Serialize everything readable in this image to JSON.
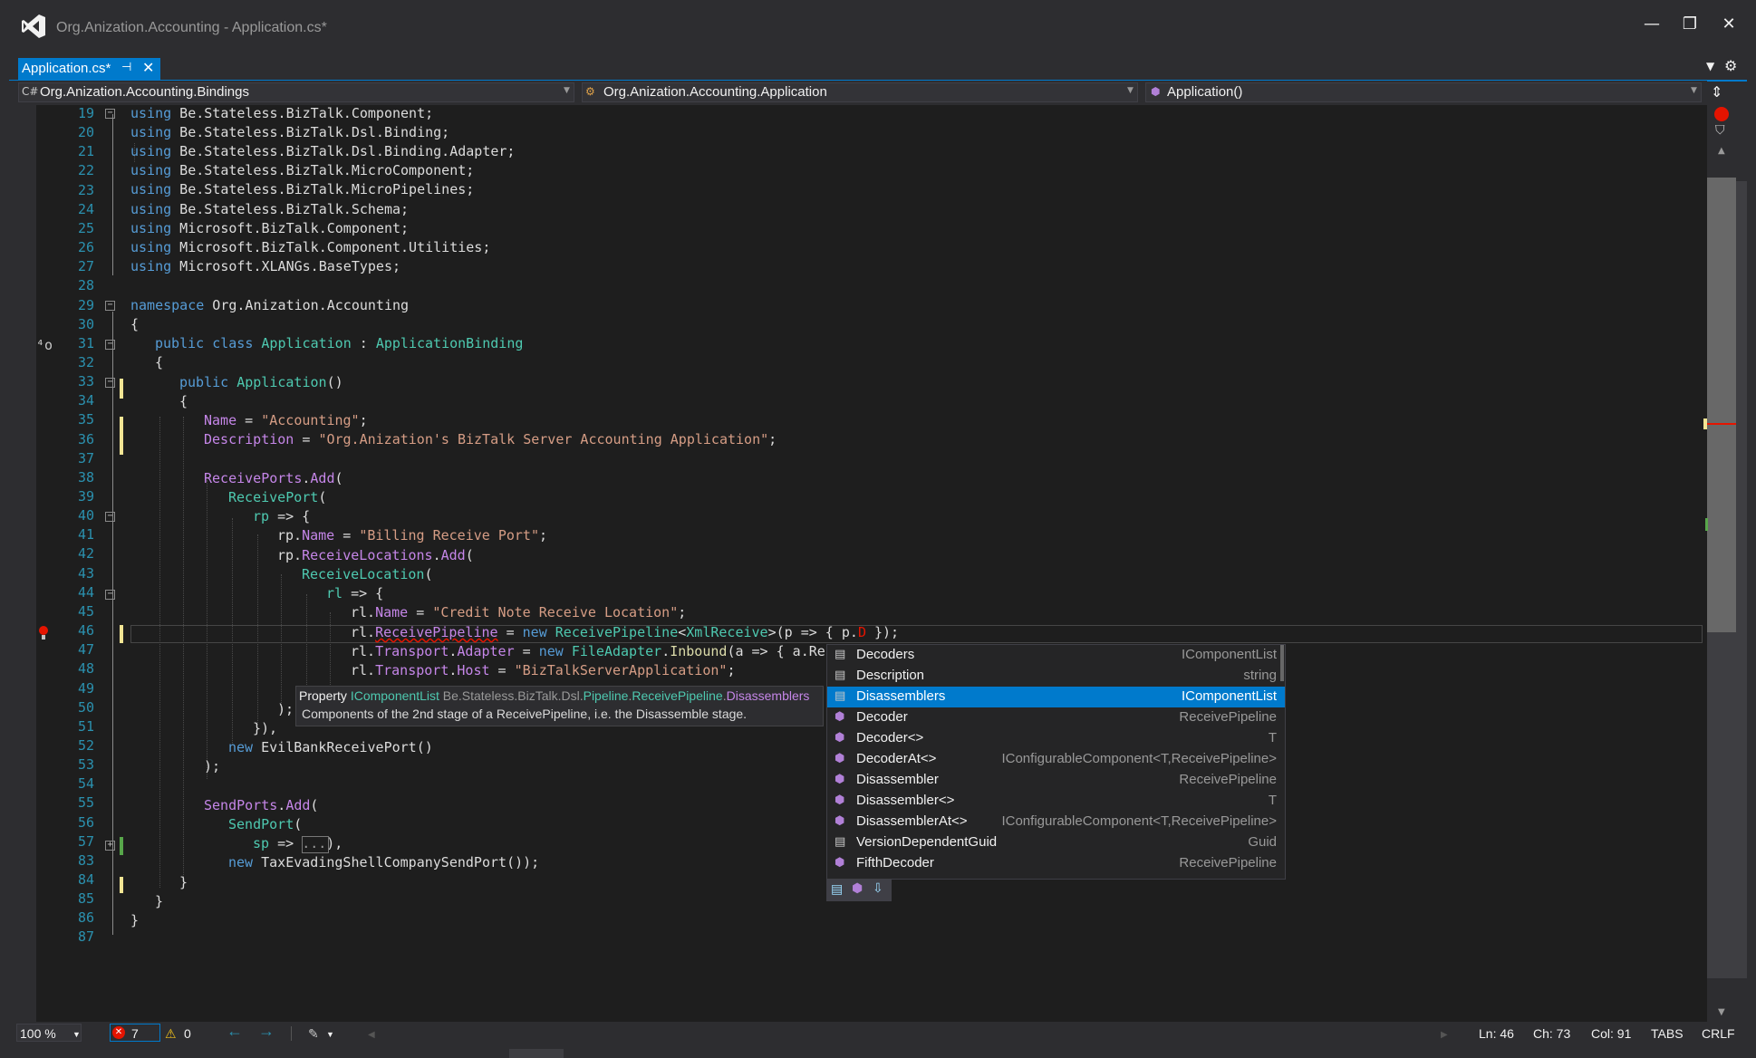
{
  "window": {
    "title": "Org.Anization.Accounting - Application.cs*",
    "minimize_glyph": "—",
    "restore_glyph": "❐",
    "close_glyph": "✕"
  },
  "tab": {
    "label": "Application.cs*",
    "pin_glyph": "⊣",
    "close_glyph": "✕",
    "active_color": "#007acc"
  },
  "navbar": {
    "project": "Org.Anization.Accounting.Bindings",
    "type": "Org.Anization.Accounting.Application",
    "member": "Application()"
  },
  "line_numbers": [
    "19",
    "20",
    "21",
    "22",
    "23",
    "24",
    "25",
    "26",
    "27",
    "28",
    "29",
    "30",
    "31",
    "32",
    "33",
    "34",
    "35",
    "36",
    "37",
    "38",
    "39",
    "40",
    "41",
    "42",
    "43",
    "44",
    "45",
    "46",
    "47",
    "48",
    "49",
    "50",
    "51",
    "52",
    "53",
    "54",
    "55",
    "56",
    "57",
    "83",
    "84",
    "85",
    "86",
    "87"
  ],
  "code": {
    "l19": [
      "using",
      " Be.Stateless.BizTalk.Component;"
    ],
    "l20": [
      "using",
      " Be.Stateless.BizTalk.Dsl.Binding;"
    ],
    "l21": [
      "using",
      " Be.Stateless.BizTalk.Dsl.Binding.Adapter;"
    ],
    "l22": [
      "using",
      " Be.Stateless.BizTalk.MicroComponent;"
    ],
    "l23": [
      "using",
      " Be.Stateless.BizTalk.MicroPipelines;"
    ],
    "l24": [
      "using",
      " Be.Stateless.BizTalk.Schema;"
    ],
    "l25": [
      "using",
      " Microsoft.BizTalk.Component;"
    ],
    "l26": [
      "using",
      " Microsoft.BizTalk.Component.Utilities;"
    ],
    "l27": [
      "using",
      " Microsoft.XLANGs.BaseTypes;"
    ],
    "l29": [
      "namespace",
      " Org.Anization.Accounting"
    ],
    "l30": "{",
    "l31": [
      "public class",
      "Application",
      " : ",
      "ApplicationBinding"
    ],
    "l32": "{",
    "l33": [
      "public",
      "Application",
      "()"
    ],
    "l34": "{",
    "l35": [
      "Name",
      " = ",
      "\"Accounting\"",
      ";"
    ],
    "l36": [
      "Description",
      " = ",
      "\"Org.Anization's BizTalk Server Accounting Application\"",
      ";"
    ],
    "l38": [
      "ReceivePorts",
      ".",
      "Add",
      "("
    ],
    "l39": [
      "ReceivePort",
      "("
    ],
    "l40": [
      "rp",
      " => {"
    ],
    "l41": [
      "rp.",
      "Name",
      " = ",
      "\"Billing Receive Port\"",
      ";"
    ],
    "l42": [
      "rp.",
      "ReceiveLocations",
      ".",
      "Add",
      "("
    ],
    "l43": [
      "ReceiveLocation",
      "("
    ],
    "l44": [
      "rl",
      " => {"
    ],
    "l45": [
      "rl.",
      "Name",
      " = ",
      "\"Credit Note Receive Location\"",
      ";"
    ],
    "l46": [
      "rl.",
      "ReceivePipeline",
      " = ",
      "new",
      "ReceivePipeline",
      "<",
      "XmlReceive",
      ">(p => { p.",
      "D",
      " });"
    ],
    "l47": [
      "rl.",
      "Transport",
      ".",
      "Adapter",
      " = ",
      "new",
      "FileAdapter",
      ".",
      "Inbound",
      "(a => { a.Re"
    ],
    "l48": [
      "rl.",
      "Transport",
      ".",
      "Host",
      " = ",
      "\"BizTalkServerApplication\"",
      ";"
    ],
    "l50": ");",
    "l51": "}),",
    "l52": [
      "new",
      "EvilBankReceivePort",
      "()"
    ],
    "l53": ");",
    "l55": [
      "SendPorts",
      ".",
      "Add",
      "("
    ],
    "l56": [
      "SendPort",
      "("
    ],
    "l57": [
      "sp",
      " => ",
      "...",
      "),"
    ],
    "l83": [
      "new",
      "TaxEvadingShellCompanySendPort",
      "());"
    ],
    "l84": "}",
    "l85": "}",
    "l86": "}"
  },
  "quickinfo": {
    "kind": "Property",
    "type": "IComponentList",
    "ns1": "Be.Stateless.BizTalk.Dsl.",
    "ns2": "Pipeline",
    "dot1": ".",
    "cls": "ReceivePipeline",
    "dot2": ".",
    "member": "Disassemblers",
    "description": "Components of the 2nd stage of a ReceivePipeline, i.e. the Disassemble stage."
  },
  "completion": {
    "items": [
      {
        "name": "Decoders",
        "type": "IComponentList",
        "icon": "property-icon",
        "glyph": "▤"
      },
      {
        "name": "Description",
        "type": "string",
        "icon": "property-icon",
        "glyph": "▤"
      },
      {
        "name": "Disassemblers",
        "type": "IComponentList",
        "icon": "property-icon",
        "glyph": "▤",
        "selected": true
      },
      {
        "name": "Decoder",
        "type": "ReceivePipeline",
        "icon": "extension-method-icon",
        "glyph": "⬢"
      },
      {
        "name": "Decoder<>",
        "type": "T",
        "icon": "extension-method-icon",
        "glyph": "⬢"
      },
      {
        "name": "DecoderAt<>",
        "type": "IConfigurableComponent<T,ReceivePipeline>",
        "icon": "extension-method-icon",
        "glyph": "⬢"
      },
      {
        "name": "Disassembler",
        "type": "ReceivePipeline",
        "icon": "extension-method-icon",
        "glyph": "⬢"
      },
      {
        "name": "Disassembler<>",
        "type": "T",
        "icon": "extension-method-icon",
        "glyph": "⬢"
      },
      {
        "name": "DisassemblerAt<>",
        "type": "IConfigurableComponent<T,ReceivePipeline>",
        "icon": "extension-method-icon",
        "glyph": "⬢"
      },
      {
        "name": "VersionDependentGuid",
        "type": "Guid",
        "icon": "property-icon",
        "glyph": "▤"
      },
      {
        "name": "FifthDecoder",
        "type": "ReceivePipeline",
        "icon": "extension-method-icon",
        "glyph": "⬢"
      }
    ],
    "filters": [
      "▤",
      "⬢",
      "⇩"
    ]
  },
  "statusbar": {
    "zoom": "100 %",
    "errors": "7",
    "warnings": "0",
    "line": "Ln: 46",
    "ch": "Ch: 73",
    "col": "Col: 91",
    "tabs": "TABS",
    "eol": "CRLF"
  }
}
